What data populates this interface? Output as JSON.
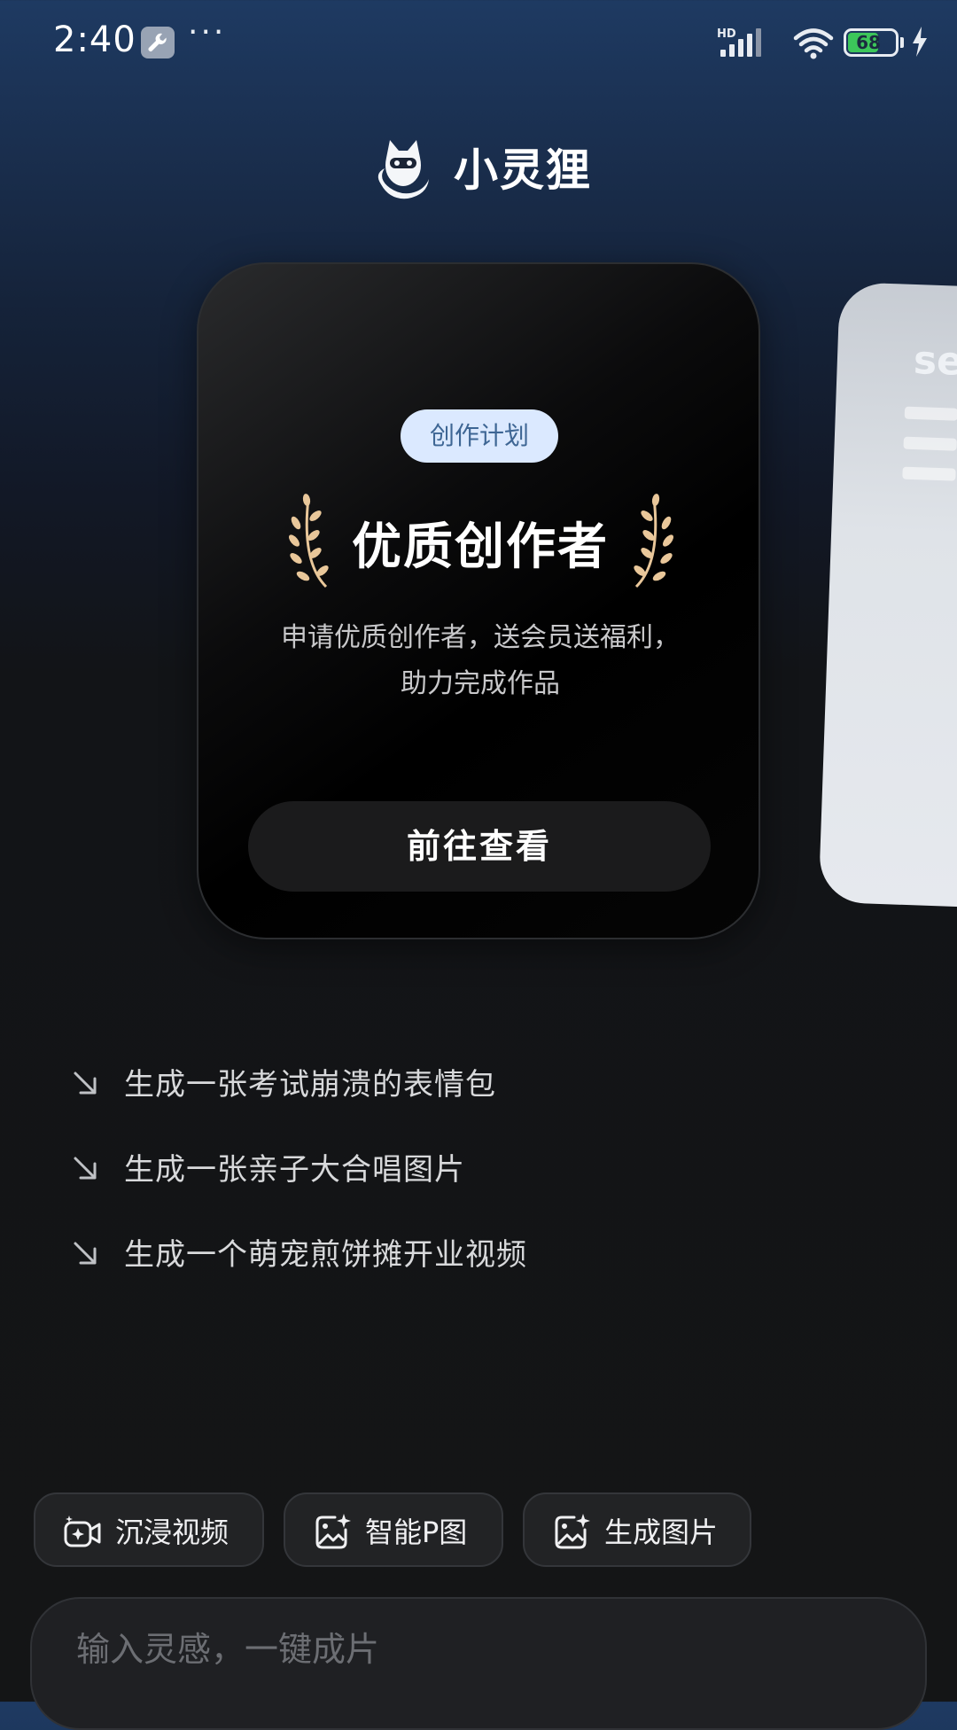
{
  "status_bar": {
    "time": "2:40",
    "more": "···",
    "network_label": "HD",
    "battery_level": "68"
  },
  "app": {
    "name": "小灵狸"
  },
  "card": {
    "tag": "创作计划",
    "title": "优质创作者",
    "description_line1": "申请优质创作者，送会员送福利，",
    "description_line2": "助力完成作品",
    "button": "前往查看"
  },
  "peek_card": {
    "title_fragment": "se"
  },
  "suggestions": [
    "生成一张考试崩溃的表情包",
    "生成一张亲子大合唱图片",
    "生成一个萌宠煎饼摊开业视频"
  ],
  "tools": [
    {
      "label": "沉浸视频",
      "icon": "video-spark-icon"
    },
    {
      "label": "智能P图",
      "icon": "image-spark-icon"
    },
    {
      "label": "生成图片",
      "icon": "image-spark-icon"
    }
  ],
  "input": {
    "placeholder": "输入灵感，一键成片"
  },
  "colors": {
    "tag_bg": "#dbe9ff",
    "tag_text": "#3e6694",
    "laurel": "#e9c79a",
    "battery_fill": "#3cc65a"
  }
}
